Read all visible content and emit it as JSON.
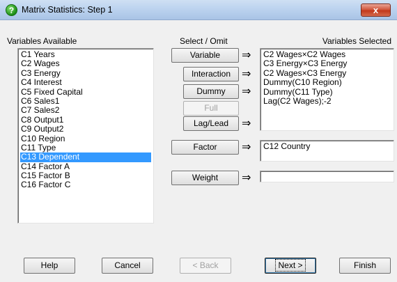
{
  "window": {
    "title": "Matrix Statistics: Step 1",
    "app_icon_glyph": "?",
    "close_glyph": "x"
  },
  "labels": {
    "variables_available": "Variables Available",
    "select_omit": "Select / Omit",
    "variables_selected": "Variables Selected"
  },
  "variables_available": [
    "C1 Years",
    "C2 Wages",
    "C3 Energy",
    "C4 Interest",
    "C5 Fixed Capital",
    "C6 Sales1",
    "C7 Sales2",
    "C8 Output1",
    "C9 Output2",
    "C10 Region",
    "C11 Type",
    "C13 Dependent",
    "C14 Factor A",
    "C15 Factor B",
    "C16 Factor C"
  ],
  "selected_available_index": 11,
  "buttons": {
    "variable": "Variable",
    "interaction": "Interaction",
    "dummy": "Dummy",
    "full": "Full",
    "lag_lead": "Lag/Lead",
    "factor": "Factor",
    "weight": "Weight",
    "help": "Help",
    "cancel": "Cancel",
    "back": "< Back",
    "next": "Next >",
    "finish": "Finish"
  },
  "arrow_glyph": "⇒",
  "variables_selected": [
    "C2 Wages×C2 Wages",
    "C3 Energy×C3 Energy",
    "C2 Wages×C3 Energy",
    "Dummy(C10 Region)",
    "Dummy(C11 Type)",
    "Lag(C2 Wages);-2"
  ],
  "factor_selected": [
    "C12 Country"
  ],
  "weight_value": ""
}
